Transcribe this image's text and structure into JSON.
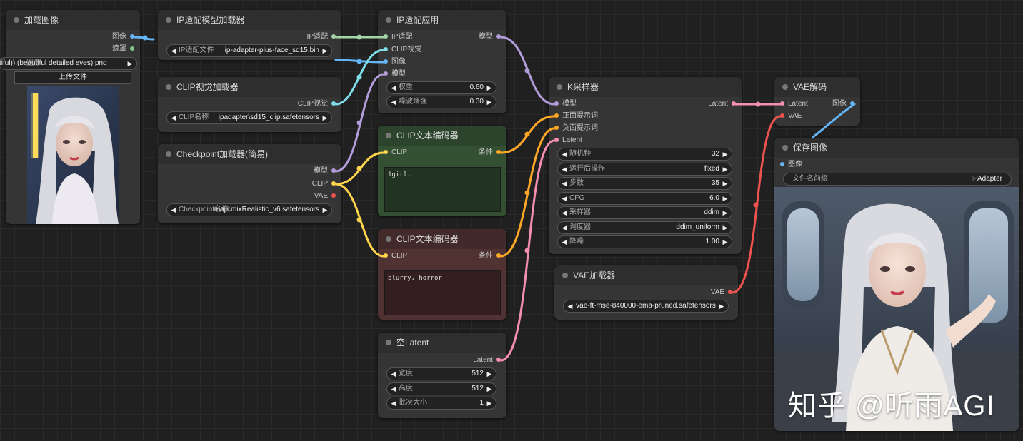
{
  "load_image": {
    "title": "加载图像",
    "out_image": "图像",
    "out_mask": "遮罩",
    "file_widget": "tiful)),(beautiful detailed eyes).png",
    "file_widget_label": "图像",
    "upload_button": "上传文件"
  },
  "ip_model_loader": {
    "title": "IP适配模型加载器",
    "out_ipadapter": "IP适配",
    "widget_label": "IP适配文件",
    "widget_value": "ip-adapter-plus-face_sd15.bin"
  },
  "clip_vision_loader": {
    "title": "CLIP视觉加载器",
    "out_clip_vision": "CLIP视觉",
    "widget_label": "CLIP名称",
    "widget_value": "ipadapter\\sd15_clip.safetensors"
  },
  "checkpoint_loader": {
    "title": "Checkpoint加载器(简易)",
    "out_model": "模型",
    "out_clip": "CLIP",
    "out_vae": "VAE",
    "widget_label": "Checkpoint名称",
    "widget_value": "majicmixRealistic_v6.safetensors"
  },
  "ip_apply": {
    "title": "IP适配应用",
    "in_ipadapter": "IP适配",
    "in_clip_vision": "CLIP视觉",
    "in_image": "图像",
    "in_model": "模型",
    "out_model": "模型",
    "weight_label": "权重",
    "weight_value": "0.60",
    "noise_label": "噪波增强",
    "noise_value": "0.30"
  },
  "clip_text_pos": {
    "title": "CLIP文本编码器",
    "in_clip": "CLIP",
    "out_cond": "条件",
    "text": "1girl,"
  },
  "clip_text_neg": {
    "title": "CLIP文本编码器",
    "in_clip": "CLIP",
    "out_cond": "条件",
    "text": "blurry, horror"
  },
  "empty_latent": {
    "title": "空Latent",
    "out_latent": "Latent",
    "width_label": "宽度",
    "width_value": "512",
    "height_label": "高度",
    "height_value": "512",
    "batch_label": "批次大小",
    "batch_value": "1"
  },
  "ksampler": {
    "title": "K采样器",
    "in_model": "模型",
    "in_positive": "正面提示词",
    "in_negative": "负面提示词",
    "in_latent": "Latent",
    "out_latent": "Latent",
    "widgets": [
      {
        "label": "随机种",
        "value": "32"
      },
      {
        "label": "运行后操作",
        "value": "fixed"
      },
      {
        "label": "步数",
        "value": "35"
      },
      {
        "label": "CFG",
        "value": "6.0"
      },
      {
        "label": "采样器",
        "value": "ddim"
      },
      {
        "label": "调度器",
        "value": "ddim_uniform"
      },
      {
        "label": "降噪",
        "value": "1.00"
      }
    ]
  },
  "vae_loader": {
    "title": "VAE加载器",
    "out_vae": "VAE",
    "widget_value": "vae-ft-mse-840000-ema-pruned.safetensors"
  },
  "vae_decode": {
    "title": "VAE解码",
    "in_latent": "Latent",
    "in_vae": "VAE",
    "out_image": "图像"
  },
  "save_image": {
    "title": "保存图像",
    "in_image": "图像",
    "prefix_label": "文件名前缀",
    "prefix_value": "IPAdapter"
  },
  "watermark": "知乎 @听雨AGI",
  "colors": {
    "model": "#b39ddb",
    "clip": "#ffd54f",
    "vae": "#ef5350",
    "image": "#64b5f6",
    "mask": "#81c784",
    "ipadapter": "#a5d6a7",
    "clip_vision": "#80deea",
    "conditioning": "#ffa726",
    "latent": "#f48fb1"
  }
}
